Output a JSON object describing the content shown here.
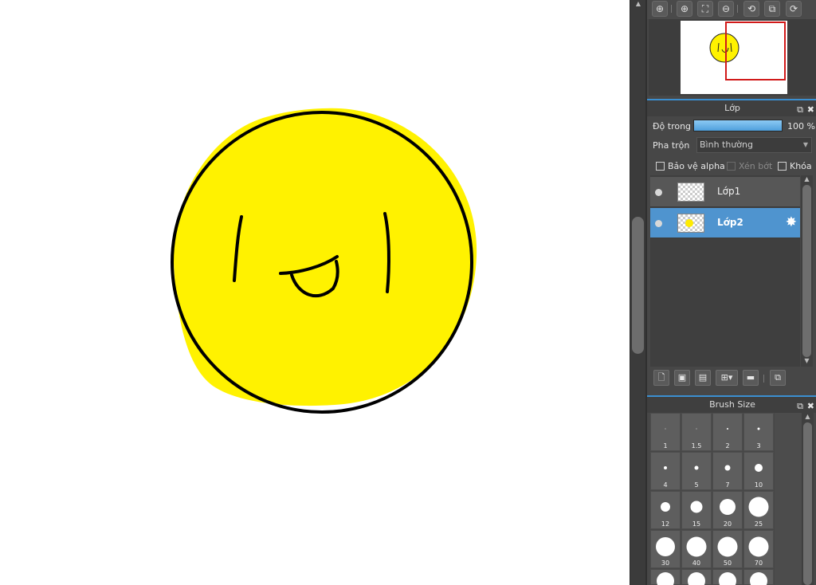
{
  "navigator": {
    "tools": [
      {
        "name": "zoom-in-icon",
        "glyph": "⊕"
      },
      {
        "name": "zoom-in-alt-icon",
        "glyph": "⊕"
      },
      {
        "name": "fit-screen-icon",
        "glyph": "⛶"
      },
      {
        "name": "zoom-out-icon",
        "glyph": "⊖"
      },
      {
        "name": "rotate-left-icon",
        "glyph": "⟲"
      },
      {
        "name": "actual-size-icon",
        "glyph": "⧉"
      },
      {
        "name": "rotate-right-icon",
        "glyph": "⟳"
      }
    ]
  },
  "layers_panel": {
    "title": "Lớp",
    "opacity_label": "Độ trong",
    "opacity_value": "100 %",
    "opacity_fraction": 1.0,
    "blend_label": "Pha trộn",
    "blend_value": "Bình thường",
    "protect_alpha_label": "Bảo vệ alpha",
    "clipping_label": "Xén bớt",
    "lock_label": "Khóa",
    "layers": [
      {
        "name": "Lớp1",
        "active": false,
        "visible": true
      },
      {
        "name": "Lớp2",
        "active": true,
        "visible": true
      }
    ],
    "accent_color": "#4f94cf"
  },
  "brush_panel": {
    "title": "Brush Size",
    "sizes": [
      "1",
      "1.5",
      "2",
      "3",
      "4",
      "5",
      "7",
      "10",
      "12",
      "15",
      "20",
      "25",
      "30",
      "40",
      "50",
      "70"
    ]
  },
  "canvas": {
    "fill_color": "#fff200",
    "stroke_color": "#000000"
  },
  "icons": {
    "popout": "⧉",
    "close": "✖",
    "gear": "✸",
    "caret": "▼",
    "up": "▲",
    "down": "▼"
  }
}
